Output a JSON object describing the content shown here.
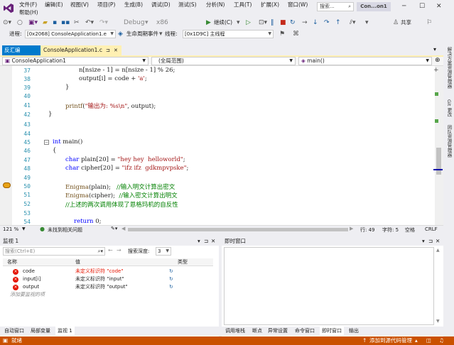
{
  "menu": {
    "items": [
      "文件(F)",
      "编辑(E)",
      "视图(V)",
      "项目(P)",
      "生成(B)",
      "调试(D)",
      "测试(S)",
      "分析(N)",
      "工具(T)",
      "扩展(X)",
      "窗口(W)"
    ],
    "help": "帮助(H)",
    "search": "搜索...",
    "project": "Con...on1"
  },
  "toolbar": {
    "debug": "Debug",
    "platform": "x86",
    "continue": "继续(C)",
    "share": "共享"
  },
  "toolbar2": {
    "process_label": "进程:",
    "process": "[0x2068] ConsoleApplication1.e",
    "lifecycle": "生命周期事件",
    "thread_label": "线程:",
    "thread": "[0x1D9C] 主线程"
  },
  "tabs": {
    "disasm": "反汇编",
    "main": "ConsoleApplication1.c"
  },
  "nav": {
    "project": "ConsoleApplication1",
    "scope": "(全局范围)",
    "func": "main()"
  },
  "code": {
    "l37": [
      "37",
      "n[nsize - 1] = n[nsize - 1] % 26;"
    ],
    "l38_a": "38",
    "l38_b": "output[i] = code + ",
    "l38_c": "'a'",
    "l39": [
      "39",
      "}"
    ],
    "l40": "40",
    "l41_a": "41",
    "l41_b": "printf",
    "l41_c": "(",
    "l41_d": "\"输出为: %s\\n\"",
    "l41_e": ", output);",
    "l42": [
      "42",
      "}"
    ],
    "l43": "43",
    "l44": "44",
    "l45_a": "45",
    "l45_b": "int",
    "l45_c": " main()",
    "l46": [
      "46",
      "{"
    ],
    "l47_a": "47",
    "l47_b": "char",
    "l47_c": " plain[20] = ",
    "l47_d": "\"hey hey  helloworld\"",
    "l47_e": ";",
    "l48_a": "48",
    "l48_b": "char",
    "l48_c": " cipher[20] = ",
    "l48_d": "\"ifz ifz  gdkmpvpske\"",
    "l48_e": ";",
    "l49": "49",
    "l50_a": "50",
    "l50_b": "Enigma",
    "l50_c": "(plain);   ",
    "l50_d": "//输入明文计算出密文",
    "l51_a": "51",
    "l51_b": "Enigma",
    "l51_c": "(cipher);  ",
    "l51_d": "//输入密文计算出明文",
    "l52_a": "52",
    "l52_b": "//上述的两次调用体现了恩格玛机的自反性",
    "l53": "53",
    "l54_a": "54",
    "l54_b": "return",
    "l54_c": " 0;"
  },
  "editor_status": {
    "zoom": "121 %",
    "issues": "未找到相关问题",
    "row": "行: 49",
    "col": "字符: 5",
    "space": "空格",
    "eol": "CRLF"
  },
  "watch": {
    "title": "监视 1",
    "search_placeholder": "搜索(Ctrl+E)",
    "depth_label": "搜索深度:",
    "depth": "3",
    "headers": {
      "name": "名称",
      "value": "值",
      "type": "类型"
    },
    "rows": [
      {
        "name": "code",
        "value": "未定义标识符 \"code\""
      },
      {
        "name": "input[i]",
        "value": "未定义标识符 \"input\""
      },
      {
        "name": "output",
        "value": "未定义标识符 \"output\""
      }
    ],
    "add": "添加要监视的项"
  },
  "immediate": {
    "title": "即时窗口"
  },
  "bottom_tabs_left": [
    "自动窗口",
    "局部变量",
    "监视 1"
  ],
  "bottom_tabs_right": [
    "调用堆栈",
    "断点",
    "异常设置",
    "命令窗口",
    "即时窗口",
    "输出"
  ],
  "right_rail": [
    "解决方案资源管理器",
    "Git 更改",
    "团队资源管理器"
  ],
  "status": {
    "ready": "就绪",
    "source": "添加到源代码管理"
  },
  "colors": {
    "accent": "#007acc",
    "status": "#ca5100",
    "tab_active": "#fff0b3"
  }
}
